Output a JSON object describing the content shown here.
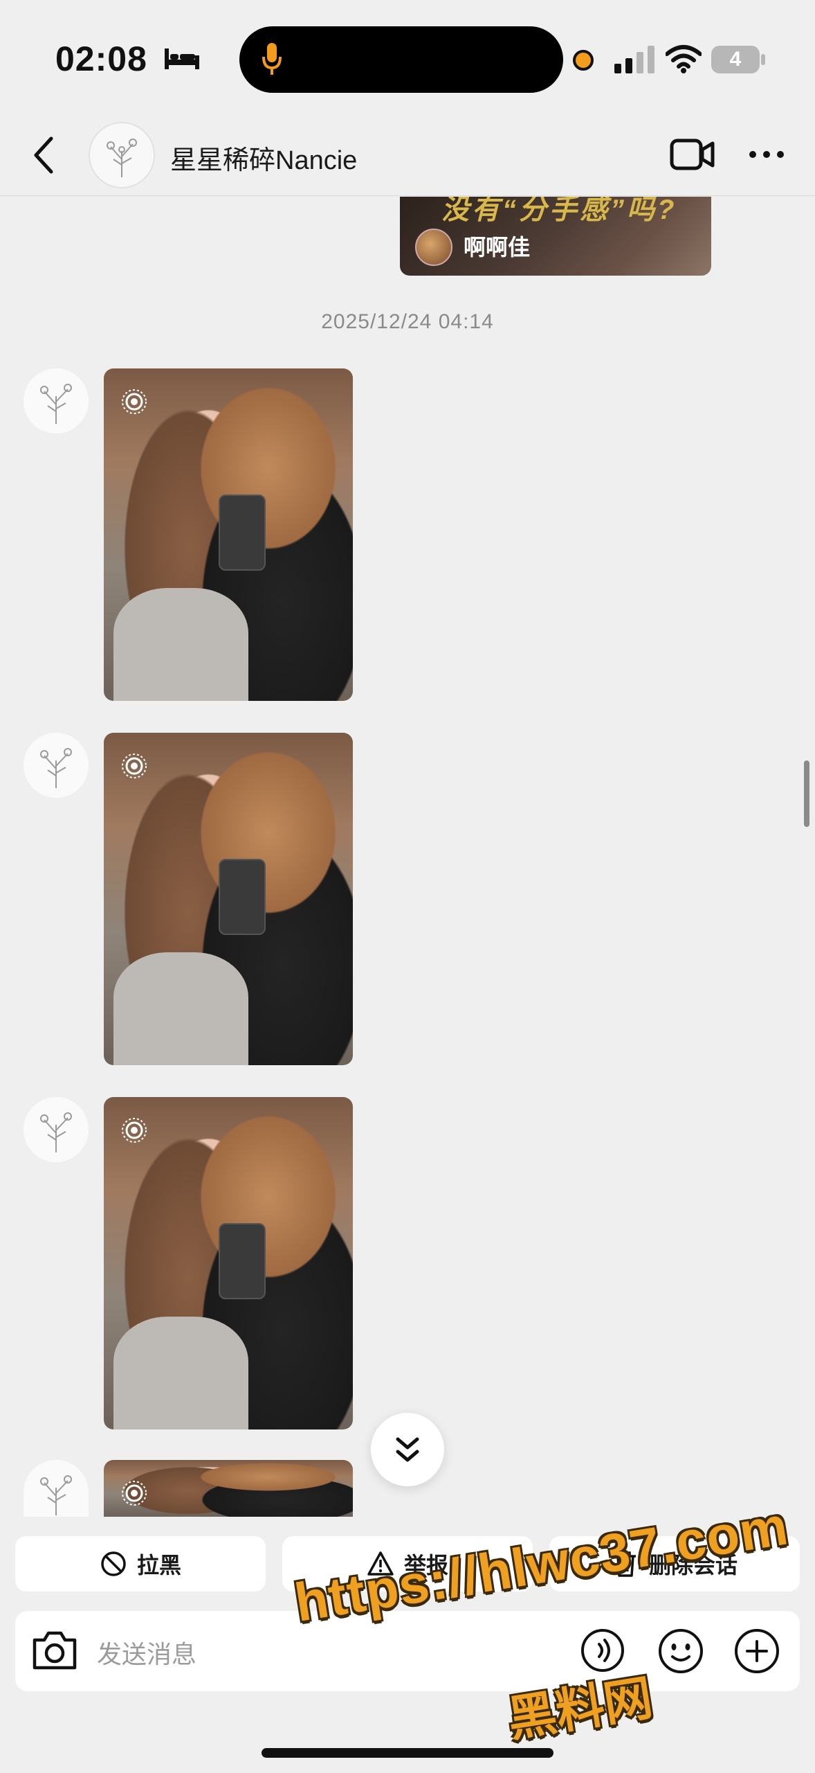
{
  "status_bar": {
    "time": "02:08",
    "battery": "4",
    "icons": [
      "bed-icon",
      "mic-icon",
      "recording-dot-icon",
      "signal-icon",
      "wifi-icon",
      "battery-icon"
    ],
    "accent": "#f29b1d"
  },
  "header": {
    "title": "星星稀碎Nancie",
    "icons": [
      "back-icon",
      "avatar",
      "video-call-icon",
      "more-icon"
    ]
  },
  "shared_video": {
    "caption_fragment": "没有“分手感”吗?",
    "author": "啊啊佳"
  },
  "timestamp": "2025/12/24 04:14",
  "messages": [
    {
      "type": "live-photo",
      "icon": "live-photo-icon"
    },
    {
      "type": "live-photo",
      "icon": "live-photo-icon"
    },
    {
      "type": "live-photo",
      "icon": "live-photo-icon"
    },
    {
      "type": "live-photo",
      "icon": "live-photo-icon"
    }
  ],
  "actions": {
    "block": "拉黑",
    "report": "举报",
    "delete_chat": "删除会话"
  },
  "input": {
    "placeholder": "发送消息"
  },
  "watermark": {
    "url": "https://hlwc37.com",
    "name": "黑料网"
  }
}
